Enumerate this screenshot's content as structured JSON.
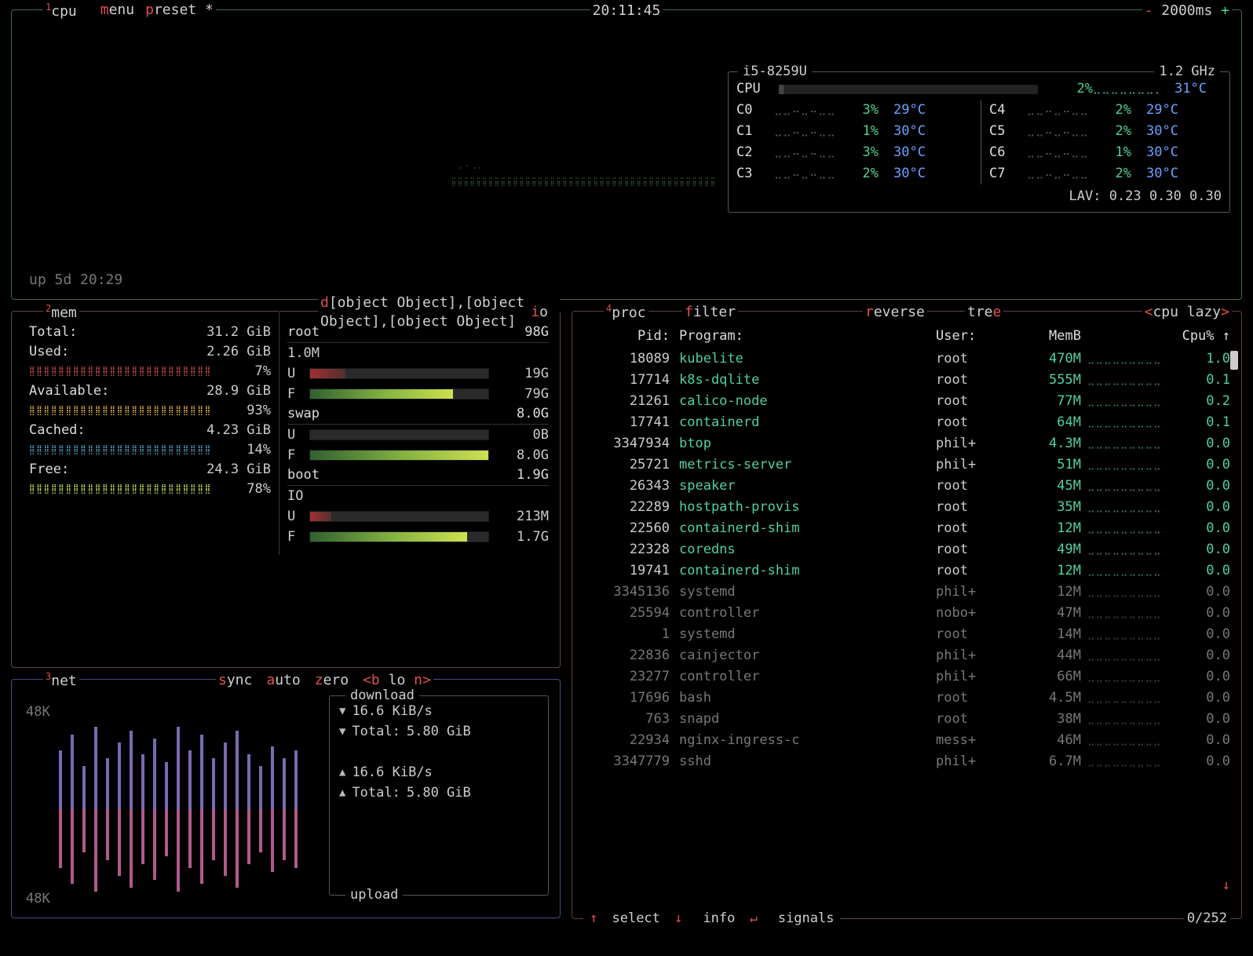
{
  "header": {
    "tabs": {
      "cpu_num": "1",
      "cpu": "cpu",
      "menu_hot": "m",
      "menu": "enu",
      "preset_hot": "p",
      "preset": "reset *"
    },
    "clock": "20:11:45",
    "rate_minus": "-",
    "rate": "2000ms",
    "rate_plus": "+"
  },
  "cpu": {
    "model": "i5-8259U",
    "freq": "1.2 GHz",
    "overall": {
      "name": "CPU",
      "pct": "2%",
      "temp": "31°C"
    },
    "cores_left": [
      {
        "name": "C0",
        "pct": "3%",
        "temp": "29°C"
      },
      {
        "name": "C1",
        "pct": "1%",
        "temp": "30°C"
      },
      {
        "name": "C2",
        "pct": "3%",
        "temp": "30°C"
      },
      {
        "name": "C3",
        "pct": "2%",
        "temp": "30°C"
      }
    ],
    "cores_right": [
      {
        "name": "C4",
        "pct": "2%",
        "temp": "29°C"
      },
      {
        "name": "C5",
        "pct": "2%",
        "temp": "30°C"
      },
      {
        "name": "C6",
        "pct": "1%",
        "temp": "30°C"
      },
      {
        "name": "C7",
        "pct": "2%",
        "temp": "30°C"
      }
    ],
    "lav_label": "LAV:",
    "lav": "0.23 0.30 0.30",
    "uptime": "up 5d 20:29"
  },
  "mem": {
    "title_num": "2",
    "title": "mem",
    "disks_hot": "d",
    "disks": [
      {
        "name": "root",
        "size": "98G",
        "rows": [
          {
            "tag": "1.0M",
            "bar": null,
            "val": ""
          },
          {
            "tag": "U",
            "fill": 20,
            "cls": "used",
            "val": "19G"
          },
          {
            "tag": "F",
            "fill": 80,
            "cls": "free",
            "val": "79G"
          }
        ]
      },
      {
        "name": "swap",
        "size": "8.0G",
        "rows": [
          {
            "tag": "U",
            "fill": 0,
            "cls": "used",
            "val": "0B"
          },
          {
            "tag": "F",
            "fill": 100,
            "cls": "free",
            "val": "8.0G"
          }
        ]
      },
      {
        "name": "boot",
        "size": "1.9G",
        "rows": [
          {
            "tag": "IO",
            "bar": null,
            "val": ""
          },
          {
            "tag": "U",
            "fill": 12,
            "cls": "used",
            "val": "213M"
          },
          {
            "tag": "F",
            "fill": 88,
            "cls": "free",
            "val": "1.7G"
          }
        ]
      }
    ],
    "io_hot": "i",
    "io": "o",
    "rows": [
      {
        "label": "Total:",
        "val": "31.2 GiB",
        "pct": "",
        "bar": ""
      },
      {
        "label": "Used:",
        "val": "2.26 GiB",
        "pct": "7%",
        "bar": "red"
      },
      {
        "label": "Available:",
        "val": "28.9 GiB",
        "pct": "93%",
        "bar": "yel"
      },
      {
        "label": "Cached:",
        "val": "4.23 GiB",
        "pct": "14%",
        "bar": "cyan"
      },
      {
        "label": "Free:",
        "val": "24.3 GiB",
        "pct": "78%",
        "bar": "grn"
      }
    ]
  },
  "net": {
    "title_num": "3",
    "title": "net",
    "sync_hot": "s",
    "sync": "ync",
    "auto_hot": "a",
    "auto": "uto",
    "zero_hot": "z",
    "zero": "ero",
    "iface_prev": "<b",
    "iface": "lo",
    "iface_next": "n>",
    "scale": "48K",
    "download": {
      "title": "download",
      "rate": "16.6 KiB/s",
      "total_label": "Total:",
      "total": "5.80 GiB"
    },
    "upload": {
      "title": "upload",
      "rate": "16.6 KiB/s",
      "total_label": "Total:",
      "total": "5.80 GiB"
    }
  },
  "proc": {
    "title_num": "4",
    "title": "proc",
    "filter_hot": "f",
    "filter": "ilter",
    "reverse_hot": "r",
    "reverse": "everse",
    "tree": "tre",
    "tree_hot": "e",
    "sort_prev": "<",
    "sort": "cpu lazy",
    "sort_next": ">",
    "cols": {
      "pid": "Pid:",
      "prog": "Program:",
      "user": "User:",
      "mem": "MemB",
      "cpu": "Cpu% ↑"
    },
    "rows": [
      {
        "pid": "18089",
        "prog": "kubelite",
        "user": "root",
        "mem": "470M",
        "cpu": "1.0",
        "dim": false
      },
      {
        "pid": "17714",
        "prog": "k8s-dqlite",
        "user": "root",
        "mem": "555M",
        "cpu": "0.1",
        "dim": false
      },
      {
        "pid": "21261",
        "prog": "calico-node",
        "user": "root",
        "mem": "77M",
        "cpu": "0.2",
        "dim": false
      },
      {
        "pid": "17741",
        "prog": "containerd",
        "user": "root",
        "mem": "64M",
        "cpu": "0.1",
        "dim": false
      },
      {
        "pid": "3347934",
        "prog": "btop",
        "user": "phil+",
        "mem": "4.3M",
        "cpu": "0.0",
        "dim": false
      },
      {
        "pid": "25721",
        "prog": "metrics-server",
        "user": "phil+",
        "mem": "51M",
        "cpu": "0.0",
        "dim": false
      },
      {
        "pid": "26343",
        "prog": "speaker",
        "user": "root",
        "mem": "45M",
        "cpu": "0.0",
        "dim": false
      },
      {
        "pid": "22289",
        "prog": "hostpath-provis",
        "user": "root",
        "mem": "35M",
        "cpu": "0.0",
        "dim": false
      },
      {
        "pid": "22560",
        "prog": "containerd-shim",
        "user": "root",
        "mem": "12M",
        "cpu": "0.0",
        "dim": false
      },
      {
        "pid": "22328",
        "prog": "coredns",
        "user": "root",
        "mem": "49M",
        "cpu": "0.0",
        "dim": false
      },
      {
        "pid": "19741",
        "prog": "containerd-shim",
        "user": "root",
        "mem": "12M",
        "cpu": "0.0",
        "dim": false
      },
      {
        "pid": "3345136",
        "prog": "systemd",
        "user": "phil+",
        "mem": "12M",
        "cpu": "0.0",
        "dim": true
      },
      {
        "pid": "25594",
        "prog": "controller",
        "user": "nobo+",
        "mem": "47M",
        "cpu": "0.0",
        "dim": true
      },
      {
        "pid": "1",
        "prog": "systemd",
        "user": "root",
        "mem": "14M",
        "cpu": "0.0",
        "dim": true
      },
      {
        "pid": "22836",
        "prog": "cainjector",
        "user": "phil+",
        "mem": "44M",
        "cpu": "0.0",
        "dim": true
      },
      {
        "pid": "23277",
        "prog": "controller",
        "user": "phil+",
        "mem": "66M",
        "cpu": "0.0",
        "dim": true
      },
      {
        "pid": "17696",
        "prog": "bash",
        "user": "root",
        "mem": "4.5M",
        "cpu": "0.0",
        "dim": true
      },
      {
        "pid": "763",
        "prog": "snapd",
        "user": "root",
        "mem": "38M",
        "cpu": "0.0",
        "dim": true
      },
      {
        "pid": "22934",
        "prog": "nginx-ingress-c",
        "user": "mess+",
        "mem": "46M",
        "cpu": "0.0",
        "dim": true
      },
      {
        "pid": "3347779",
        "prog": "sshd",
        "user": "phil+",
        "mem": "6.7M",
        "cpu": "0.0",
        "dim": true
      }
    ],
    "foot": {
      "select": "select",
      "info": "info",
      "signals": "signals",
      "pos": "0/252"
    }
  }
}
